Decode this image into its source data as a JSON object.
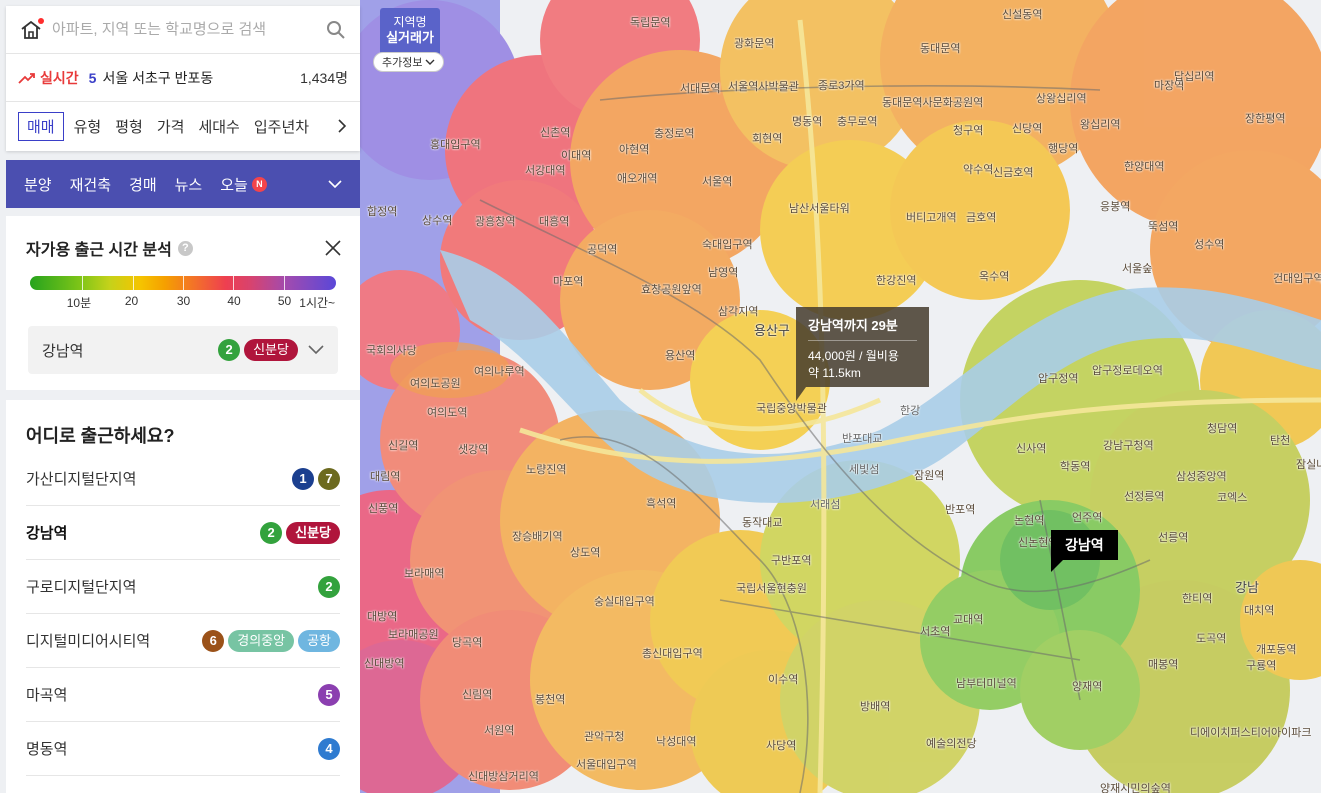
{
  "search": {
    "placeholder": "아파트, 지역 또는 학교명으로 검색"
  },
  "realtime": {
    "label": "실시간",
    "rank": "5",
    "area": "서울 서초구 반포동",
    "count": "1,434명"
  },
  "filters": {
    "items": [
      "매매",
      "유형",
      "평형",
      "가격",
      "세대수",
      "입주년차"
    ]
  },
  "nav": {
    "items": [
      "분양",
      "재건축",
      "경매",
      "뉴스",
      "오늘"
    ],
    "badge": "N"
  },
  "analysis": {
    "title": "자가용 출근 시간 분석",
    "help": "?",
    "scale_labels": [
      "10분",
      "20",
      "30",
      "40",
      "50",
      "1시간~"
    ],
    "station": {
      "name": "강남역",
      "line": "2",
      "tag": "신분당"
    }
  },
  "destinations": {
    "title": "어디로 출근하세요?",
    "items": [
      {
        "name": "가산디지털단지역",
        "badges": [
          {
            "text": "1",
            "color": "#1b3f8f"
          },
          {
            "text": "7",
            "color": "#6c6a1f"
          }
        ],
        "tags": []
      },
      {
        "name": "강남역",
        "badges": [
          {
            "text": "2",
            "color": "#33a23d"
          }
        ],
        "tags": [
          {
            "text": "신분당",
            "color": "#b0153c"
          }
        ]
      },
      {
        "name": "구로디지털단지역",
        "badges": [
          {
            "text": "2",
            "color": "#33a23d"
          }
        ],
        "tags": []
      },
      {
        "name": "디지털미디어시티역",
        "badges": [
          {
            "text": "6",
            "color": "#9b5219"
          }
        ],
        "tags": [
          {
            "text": "경의중앙",
            "color": "#77c4a3"
          },
          {
            "text": "공항",
            "color": "#6fb6e0"
          }
        ]
      },
      {
        "name": "마곡역",
        "badges": [
          {
            "text": "5",
            "color": "#8b3fb0"
          }
        ],
        "tags": []
      },
      {
        "name": "명동역",
        "badges": [
          {
            "text": "4",
            "color": "#2f7bd0"
          }
        ],
        "tags": []
      }
    ]
  },
  "map_controls": {
    "price_line1": "지역명",
    "price_line2": "실거래가",
    "extra_info": "추가정보"
  },
  "tooltip": {
    "title": "강남역까지 29분",
    "line1": "44,000원 / 월비용",
    "line2": "약 11.5km"
  },
  "station_marker": "강남역",
  "map_labels": [
    "독립문역",
    "신설동역",
    "광화문역",
    "종로3가역",
    "동대문역",
    "서대문역",
    "서울역사박물관",
    "충무로역",
    "명동역",
    "회현역",
    "동대문역사문화공원역",
    "신당역",
    "상왕십리역",
    "왕십리역",
    "행당역",
    "마장역",
    "답십리역",
    "장한평역",
    "신촌역",
    "이대역",
    "아현역",
    "애오개역",
    "충정로역",
    "서울역",
    "남산서울타워",
    "버티고개역",
    "약수역",
    "금호역",
    "청구역",
    "신금호역",
    "옥수역",
    "뚝섬역",
    "성수역",
    "서울숲",
    "건대입구역",
    "홍대입구역",
    "상수역",
    "광흥창역",
    "대흥역",
    "합정역",
    "공덕역",
    "효창공원앞역",
    "숙대입구역",
    "남영역",
    "삼각지역",
    "한강진역",
    "용산구",
    "서강대역",
    "마포역",
    "용산역",
    "국회의사당",
    "여의나루역",
    "여의도역",
    "여의도공원",
    "국립중앙박물관",
    "한강",
    "압구정역",
    "압구정로데오역",
    "청담역",
    "응봉역",
    "신길역",
    "샛강역",
    "노량진역",
    "흑석역",
    "동작대교",
    "반포대교",
    "구반포역",
    "서래섬",
    "세빛섬",
    "잠원역",
    "신사역",
    "강남구청역",
    "학동역",
    "삼성중앙역",
    "선정릉역",
    "코엑스",
    "반포역",
    "논현역",
    "신논현역",
    "언주역",
    "보라매역",
    "대방역",
    "장승배기역",
    "상도역",
    "숭실대입구역",
    "총신대입구역",
    "국립서울현충원",
    "교대역",
    "서초역",
    "양재역",
    "매봉역",
    "도곡역",
    "한티역",
    "선릉역",
    "대치역",
    "구룡역",
    "개포동역",
    "신대방역",
    "보라매공원",
    "당곡역",
    "신림역",
    "봉천역",
    "서울대입구역",
    "낙성대역",
    "사당역",
    "이수역",
    "방배역",
    "남부터미널역",
    "예술의전당",
    "신풍역",
    "대림역",
    "신대방삼거리역",
    "서원역",
    "관악구청",
    "강남",
    "양재시민의숲역",
    "디에이치퍼스티어아이파크",
    "한양대역",
    "잠실나루역",
    "탄천"
  ]
}
